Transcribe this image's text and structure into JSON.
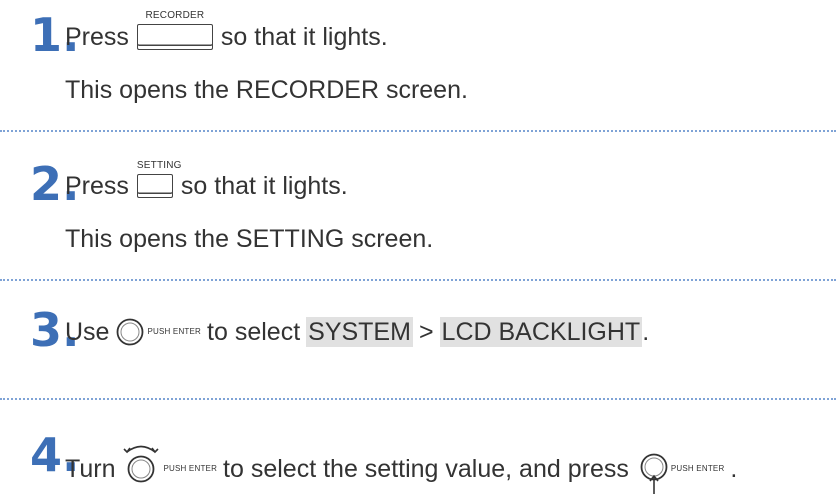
{
  "steps": [
    {
      "number": "1.",
      "pre": "Press",
      "key_label": "RECORDER",
      "post": "so that it lights.",
      "sub": "This opens the RECORDER screen."
    },
    {
      "number": "2.",
      "pre": "Press",
      "key_label": "SETTING",
      "post": "so that it lights.",
      "sub": "This opens the SETTING screen."
    },
    {
      "number": "3.",
      "pre": "Use",
      "dial_label": "PUSH ENTER",
      "mid": "to select",
      "menu1": "SYSTEM",
      "sep": ">",
      "menu2": "LCD BACKLIGHT",
      "end": "."
    },
    {
      "number": "4.",
      "pre": "Turn",
      "dial_label": "PUSH ENTER",
      "mid": "to select the setting value, and press",
      "dial2_label": "PUSH ENTER",
      "end": "."
    }
  ],
  "colors": {
    "step_number": "#3d6fb6",
    "divider": "#7fa3d6",
    "highlight": "#e1e1e1"
  }
}
